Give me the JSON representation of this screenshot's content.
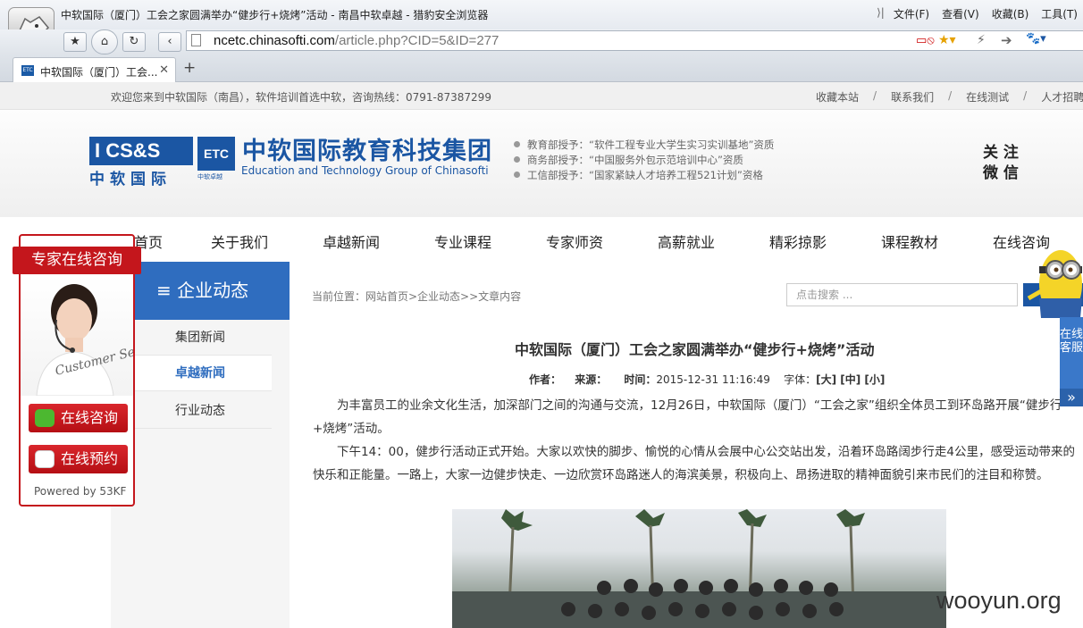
{
  "browser": {
    "window_title": "中软国际（厦门）工会之家圆满举办“健步行+烧烤”活动 - 南昌中软卓越 - 猎豹安全浏览器",
    "menus": [
      "文件(F)",
      "查看(V)",
      "收藏(B)",
      "工具(T)"
    ],
    "url_host": "ncetc.chinasofti.com",
    "url_path": "/article.php?CID=5&ID=277",
    "tab_title": "中软国际（厦门）工会...",
    "tab_favicon": "ETC"
  },
  "site": {
    "welcome": "欢迎您来到中软国际（南昌），软件培训首选中软，咨询热线：0791-87387299",
    "top_links": [
      "收藏本站",
      "联系我们",
      "在线测试",
      "人才招聘"
    ],
    "logo_box": "I CS&S",
    "logo_box_cn": "中软国际",
    "logo_etc": "ETC",
    "logo_etc_cn": "中软卓越",
    "brand_cn": "中软国际教育科技集团",
    "brand_en": "Education and Technology Group of Chinasofti",
    "awards": [
      "教育部授予：“软件工程专业大学生实习实训基地”资质",
      "商务部授予：“中国服务外包示范培训中心”资质",
      "工信部授予：“国家紧缺人才培养工程521计划”资格"
    ],
    "follow_line1": "关 注",
    "follow_line2": "微 信",
    "nav": [
      "首页",
      "关于我们",
      "卓越新闻",
      "专业课程",
      "专家师资",
      "高薪就业",
      "精彩掠影",
      "课程教材",
      "在线咨询"
    ]
  },
  "sidebar": {
    "section_title": "≡ 企业动态",
    "items": [
      "集团新闻",
      "卓越新闻",
      "行业动态"
    ]
  },
  "kf_widget": {
    "title": "专家在线咨询",
    "btn_chat": "在线咨询",
    "btn_book": "在线预约",
    "powered": "Powered by 53KF",
    "script_text": "Customer Service"
  },
  "content": {
    "breadcrumb": "当前位置：网站首页>企业动态>>文章内容",
    "search_placeholder": "点击搜索 ...",
    "title": "中软国际（厦门）工会之家圆满举办“健步行+烧烤”活动",
    "meta_author_label": "作者：",
    "meta_source_label": "来源：",
    "meta_time_label": "时间：",
    "meta_time": "2015-12-31 11:16:49",
    "meta_font_label": "字体：",
    "meta_font_sizes": "[大] [中] [小]",
    "para1": "为丰富员工的业余文化生活，加深部门之间的沟通与交流，12月26日，中软国际（厦门）“工会之家”组织全体员工到环岛路开展“健步行+烧烤”活动。",
    "para2": "下午14：00，健步行活动正式开始。大家以欢快的脚步、愉悦的心情从会展中心公交站出发，沿着环岛路阔步行走4公里，感受运动带来的快乐和正能量。一路上，大家一边健步快走、一边欣赏环岛路迷人的海滨美景，积极向上、昂扬进取的精神面貌引来市民们的注目和称赞。"
  },
  "right_float": {
    "label": "在线客服",
    "arrow": "»"
  },
  "watermark": "wooyun.org"
}
